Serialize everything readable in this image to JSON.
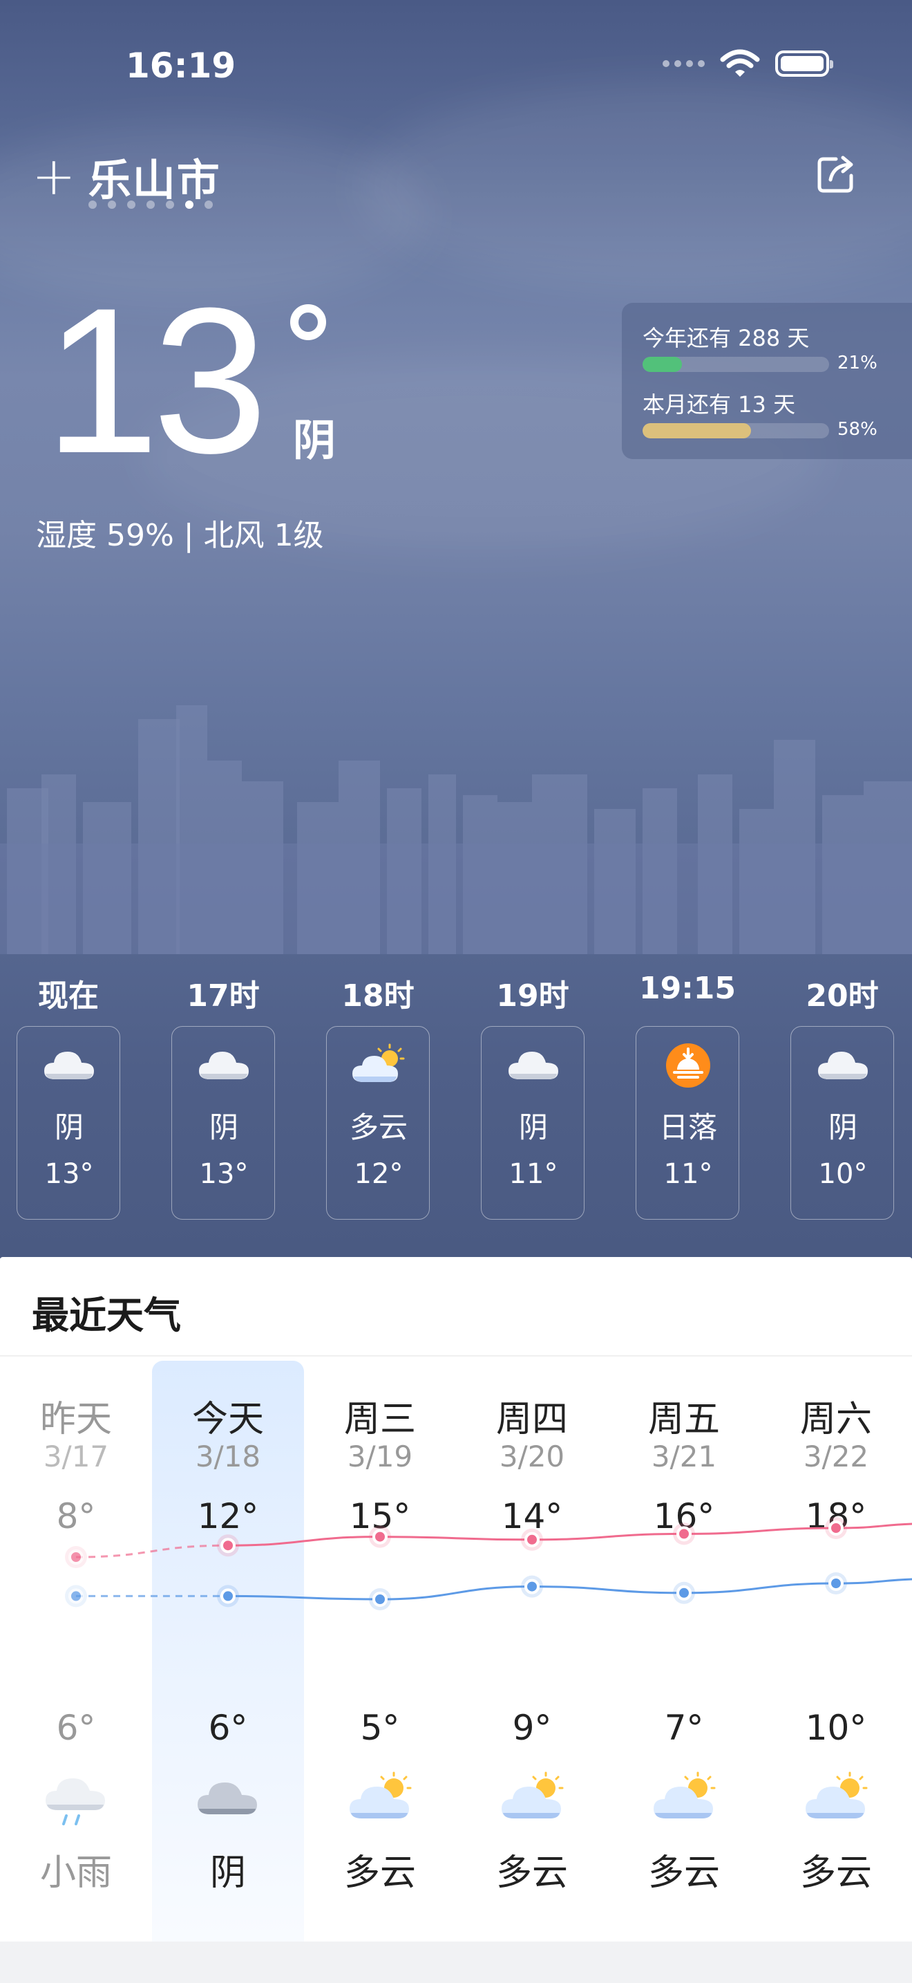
{
  "status_bar": {
    "time": "16:19"
  },
  "header": {
    "city": "乐山市",
    "add_symbol": "+",
    "page_count": 7,
    "active_page": 5
  },
  "current": {
    "temperature": "13",
    "condition": "阴",
    "details": "湿度 59% | 北风 1级"
  },
  "progress": {
    "year": {
      "label": "今年还有 288 天",
      "percent_text": "21%",
      "value": 0.21,
      "color": "#52c17a"
    },
    "month": {
      "label": "本月还有 13 天",
      "percent_text": "58%",
      "value": 0.58,
      "color": "#dcc07c"
    }
  },
  "hourly": [
    {
      "time": "现在",
      "condition": "阴",
      "temp": "13°",
      "icon": "cloud-icon"
    },
    {
      "time": "17时",
      "condition": "阴",
      "temp": "13°",
      "icon": "cloud-icon"
    },
    {
      "time": "18时",
      "condition": "多云",
      "temp": "12°",
      "icon": "partly-cloudy-icon"
    },
    {
      "time": "19时",
      "condition": "阴",
      "temp": "11°",
      "icon": "cloud-icon"
    },
    {
      "time": "19:15",
      "condition": "日落",
      "temp": "11°",
      "icon": "sunset-icon"
    },
    {
      "time": "20时",
      "condition": "阴",
      "temp": "10°",
      "icon": "cloud-icon"
    }
  ],
  "recent": {
    "title": "最近天气",
    "days": [
      {
        "name": "昨天",
        "date": "3/17",
        "high": "8°",
        "low": "6°",
        "condition": "小雨",
        "icon": "rain-icon",
        "past": true
      },
      {
        "name": "今天",
        "date": "3/18",
        "high": "12°",
        "low": "6°",
        "condition": "阴",
        "icon": "cloud-icon",
        "past": false
      },
      {
        "name": "周三",
        "date": "3/19",
        "high": "15°",
        "low": "5°",
        "condition": "多云",
        "icon": "partly-cloudy-icon",
        "past": false
      },
      {
        "name": "周四",
        "date": "3/20",
        "high": "14°",
        "low": "9°",
        "condition": "多云",
        "icon": "partly-cloudy-icon",
        "past": false
      },
      {
        "name": "周五",
        "date": "3/21",
        "high": "16°",
        "low": "7°",
        "condition": "多云",
        "icon": "partly-cloudy-icon",
        "past": false
      },
      {
        "name": "周六",
        "date": "3/22",
        "high": "18°",
        "low": "10°",
        "condition": "多云",
        "icon": "partly-cloudy-icon",
        "past": false
      }
    ],
    "colors": {
      "high_line": "#f06b8e",
      "low_line": "#5d9ae6"
    }
  }
}
